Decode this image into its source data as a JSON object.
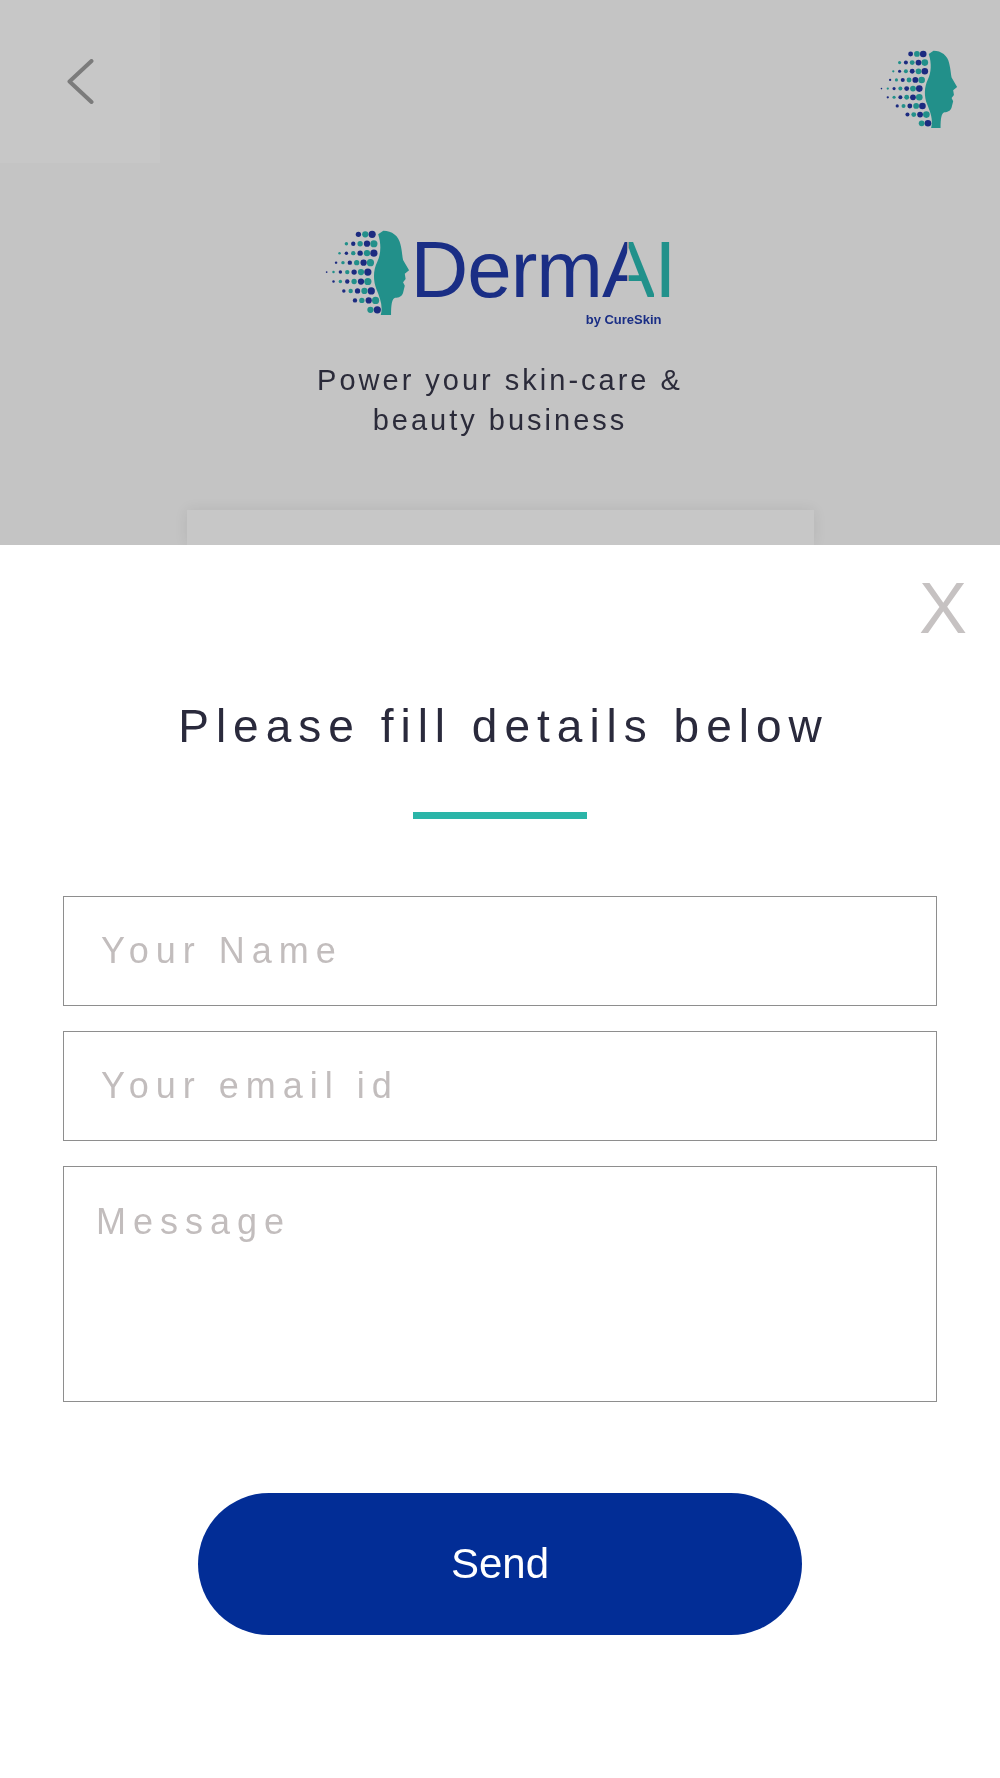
{
  "brand": {
    "wordmark": "DermAI",
    "byline": "by CureSkin",
    "tagline": "Power your skin-care & beauty business"
  },
  "modal": {
    "close": "X",
    "title": "Please fill details below",
    "fields": [
      {
        "kind": "input",
        "placeholder": "Your Name"
      },
      {
        "kind": "input",
        "placeholder": "Your email id"
      },
      {
        "kind": "textarea",
        "placeholder": "Message"
      }
    ],
    "submit": "Send"
  }
}
